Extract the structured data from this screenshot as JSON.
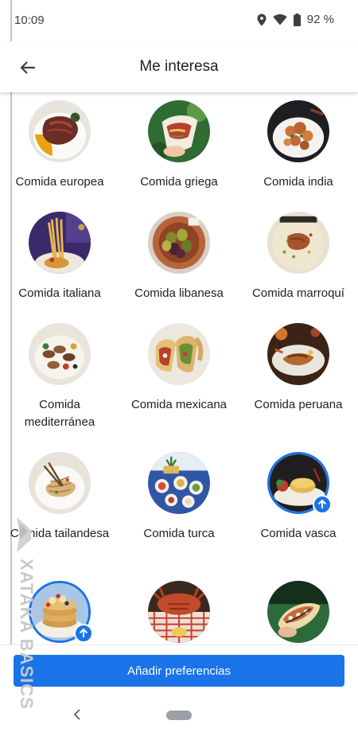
{
  "status_bar": {
    "time": "10:09",
    "battery": "92 %"
  },
  "header": {
    "title": "Me interesa"
  },
  "cuisines": [
    {
      "label": "Comida europea",
      "selected": false
    },
    {
      "label": "Comida griega",
      "selected": false
    },
    {
      "label": "Comida india",
      "selected": false
    },
    {
      "label": "Comida italiana",
      "selected": false
    },
    {
      "label": "Comida libanesa",
      "selected": false
    },
    {
      "label": "Comida marroquí",
      "selected": false
    },
    {
      "label": "Comida mediterránea",
      "selected": false
    },
    {
      "label": "Comida mexicana",
      "selected": false
    },
    {
      "label": "Comida peruana",
      "selected": false
    },
    {
      "label": "Comida tailandesa",
      "selected": false
    },
    {
      "label": "Comida turca",
      "selected": false
    },
    {
      "label": "Comida vasca",
      "selected": true
    },
    {
      "label": "",
      "selected": true
    },
    {
      "label": "",
      "selected": false
    },
    {
      "label": "",
      "selected": false
    }
  ],
  "footer": {
    "button_label": "Añadir preferencias"
  },
  "watermark": {
    "text": "XATAKA BASICS"
  },
  "colors": {
    "accent": "#1a73e8"
  }
}
